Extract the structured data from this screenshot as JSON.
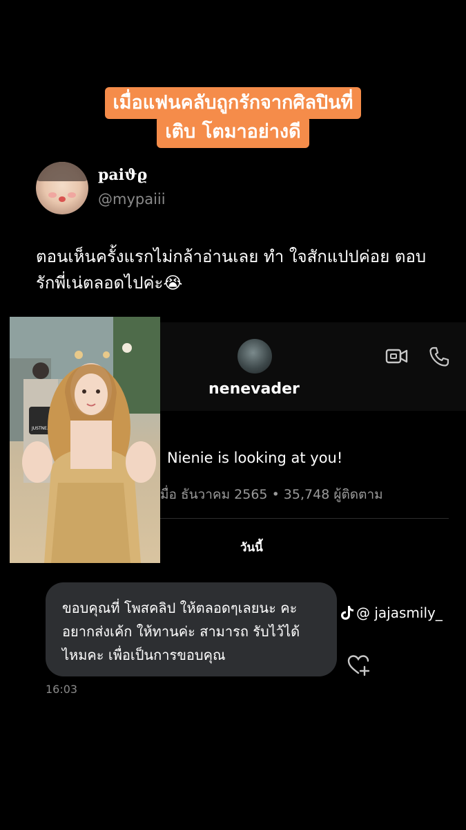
{
  "caption": {
    "line1": "เมื่อแฟนคลับถูกรักจากศิลปินที่",
    "line2": "เติบ โตมาอย่างดี",
    "accent_color": "#f58c4a"
  },
  "post": {
    "display_name": "paiϑϱ",
    "handle": "@mypaiii",
    "text": "ตอนเห็นครั้งแรกไม่กล้าอ่านเลย ทำ ใจสักแปปค่อย ตอบ รักพี่เน่ตลอดไปค่ะ😭"
  },
  "chat": {
    "profile_name": "nenevader",
    "bio": "Nienie is looking at you!",
    "meta": "มื่อ ธันวาคม 2565 • 35,748 ผู้ติดตาม",
    "day_label": "วันนี้",
    "icons": [
      "video-call-icon",
      "phone-call-icon"
    ],
    "message": {
      "text": "ขอบคุณที่ โพสคลิป ให้ตลอดๆเลยนะ คะ อยากส่งเค้ก ให้ทานค่ะ สามารถ รับไว้ได้ไหมคะ เพื่อเป็นการขอบคุณ",
      "time": "16:03",
      "bubble_color": "#2d2f32"
    }
  },
  "watermark": {
    "icon": "tiktok-icon",
    "text": "@ jajasmily_"
  }
}
